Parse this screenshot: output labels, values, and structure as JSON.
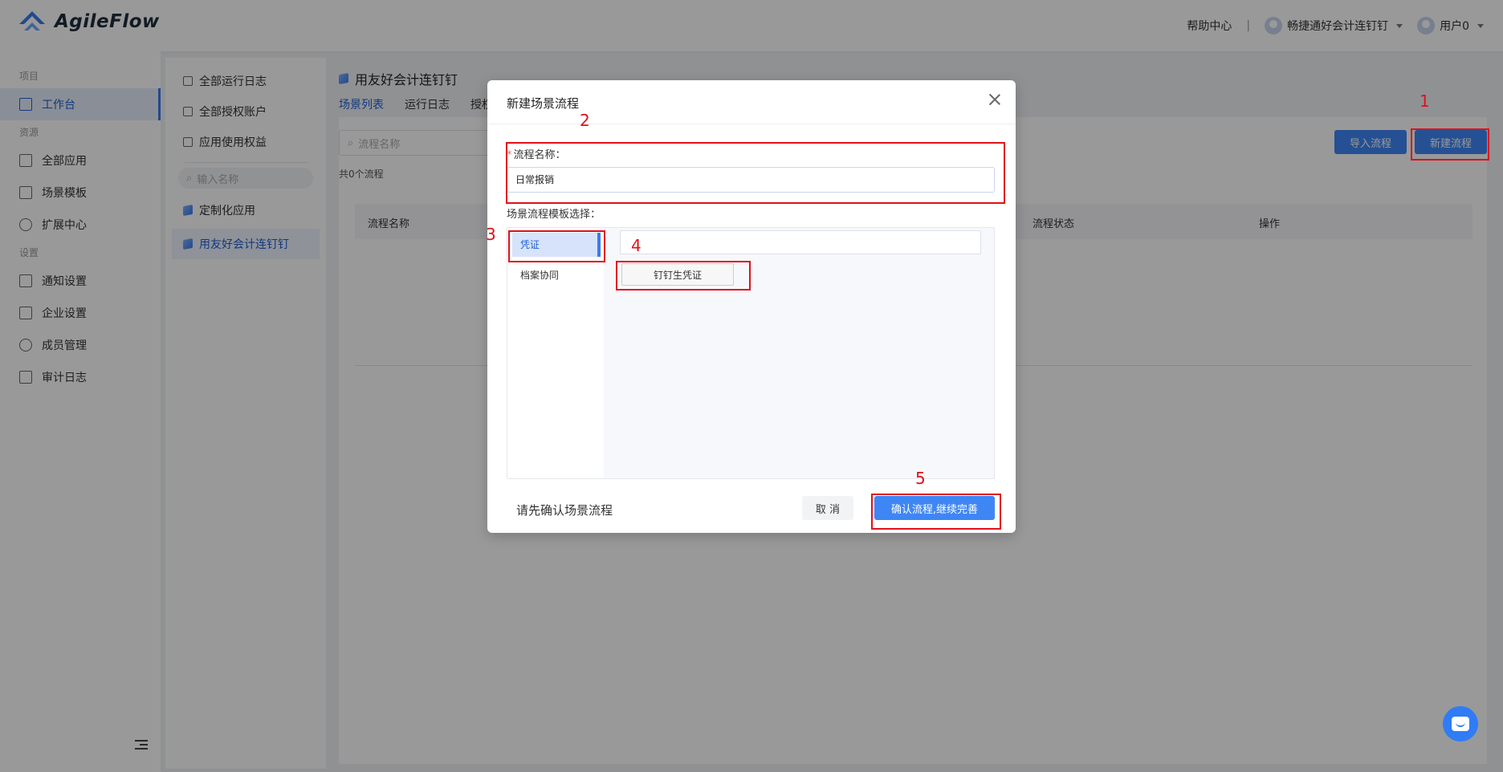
{
  "app": {
    "brand": "AgileFlow"
  },
  "header": {
    "help": "帮助中心",
    "separator": "|",
    "org": "畅捷通好会计连钉钉",
    "user": "用户0"
  },
  "sidebar": {
    "groups": [
      {
        "label": "项目"
      },
      {
        "label": "资源"
      },
      {
        "label": "设置"
      }
    ],
    "items": [
      {
        "label": "工作台",
        "icon": "workbench-icon",
        "active": true
      },
      {
        "label": "全部应用",
        "icon": "apps-grid-icon"
      },
      {
        "label": "场景模板",
        "icon": "template-icon"
      },
      {
        "label": "扩展中心",
        "icon": "puzzle-icon"
      },
      {
        "label": "通知设置",
        "icon": "notification-icon"
      },
      {
        "label": "企业设置",
        "icon": "enterprise-icon"
      },
      {
        "label": "成员管理",
        "icon": "members-icon"
      },
      {
        "label": "审计日志",
        "icon": "audit-log-icon"
      }
    ]
  },
  "subnav": {
    "items": [
      {
        "label": "全部运行日志",
        "icon": "layers-icon"
      },
      {
        "label": "全部授权账户",
        "icon": "grid-icon"
      },
      {
        "label": "应用使用权益",
        "icon": "bag-icon"
      }
    ],
    "search_placeholder": "输入名称",
    "apps": [
      {
        "label": "定制化应用",
        "icon": "cube-icon"
      },
      {
        "label": "用友好会计连钉钉",
        "icon": "cube-icon",
        "active": true
      }
    ]
  },
  "main": {
    "title": "用友好会计连钉钉",
    "tabs": [
      {
        "label": "场景列表",
        "active": true
      },
      {
        "label": "运行日志"
      },
      {
        "label": "授权"
      }
    ],
    "search_placeholder": "流程名称",
    "count": "共0个流程",
    "import_button": "导入流程",
    "new_button": "新建流程",
    "columns": [
      "流程名称",
      "流程状态",
      "操作"
    ]
  },
  "modal": {
    "title": "新建场景流程",
    "name_label": "流程名称：",
    "required_mark": "*",
    "name_value": "日常报销",
    "template_label": "场景流程模板选择：",
    "categories": [
      {
        "label": "凭证",
        "active": true
      },
      {
        "label": "档案协同"
      }
    ],
    "template_chip": "钉钉生凭证",
    "footer_text": "请先确认场景流程",
    "cancel": "取 消",
    "confirm": "确认流程,继续完善"
  },
  "annotations": [
    "1",
    "2",
    "3",
    "4",
    "5"
  ],
  "colors": {
    "accent": "#3f86f5",
    "annotation": "#e0101a",
    "active_bg": "#e6eefc"
  }
}
